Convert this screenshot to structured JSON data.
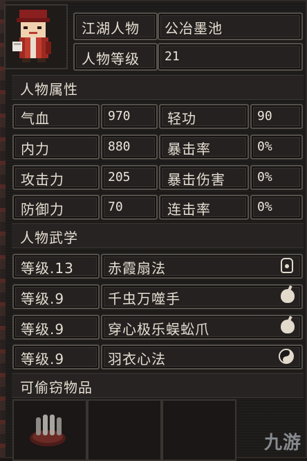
{
  "profile": {
    "name_label": "江湖人物",
    "name_value": "公冶墨池",
    "level_label": "人物等级",
    "level_value": "21"
  },
  "attributes": {
    "header": "人物属性",
    "rows": [
      {
        "left_label": "气血",
        "left_value": "970",
        "right_label": "轻功",
        "right_value": "90"
      },
      {
        "left_label": "内力",
        "left_value": "880",
        "right_label": "暴击率",
        "right_value": "0%"
      },
      {
        "left_label": "攻击力",
        "left_value": "205",
        "right_label": "暴击伤害",
        "right_value": "0%"
      },
      {
        "left_label": "防御力",
        "left_value": "70",
        "right_label": "连击率",
        "right_value": "0%"
      }
    ]
  },
  "martial": {
    "header": "人物武学",
    "skills": [
      {
        "level": "等级.13",
        "name": "赤霞扇法",
        "icon": "fan-icon"
      },
      {
        "level": "等级.9",
        "name": "千虫万噬手",
        "icon": "palm-icon"
      },
      {
        "level": "等级.9",
        "name": "穿心极乐蜈蚣爪",
        "icon": "palm-icon"
      },
      {
        "level": "等级.9",
        "name": "羽衣心法",
        "icon": "yin-yang-icon"
      }
    ]
  },
  "steal": {
    "header": "可偷窃物品"
  },
  "watermark": "九游",
  "colors": {
    "panel_bg": "#242120",
    "border": "#55504b",
    "text": "#e9e2d6"
  }
}
